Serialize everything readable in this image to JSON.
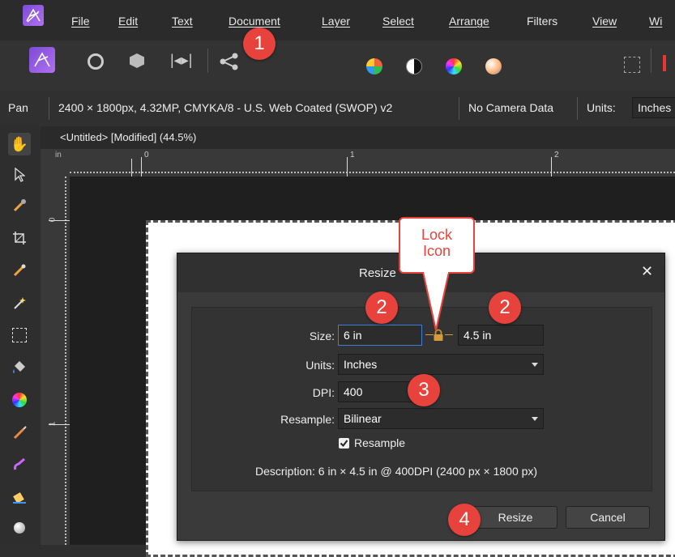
{
  "menubar": {
    "items": [
      "File",
      "Edit",
      "Text",
      "Document",
      "Layer",
      "Select",
      "Arrange",
      "Filters",
      "View",
      "Wi"
    ]
  },
  "contextbar": {
    "tool": "Pan",
    "doc_info": "2400 × 1800px, 4.32MP, CMYKA/8 - U.S. Web Coated (SWOP) v2",
    "camera": "No Camera Data",
    "units_label": "Units:",
    "units_value": "Inches"
  },
  "doc_tab": {
    "title": "<Untitled> [Modified] (44.5%)"
  },
  "ruler": {
    "unit": "in",
    "top_ticks": [
      "0",
      "1",
      "2"
    ],
    "left_ticks": [
      "0",
      "1"
    ]
  },
  "dialog": {
    "title": "Resize",
    "close": "✕",
    "size_label": "Size:",
    "width_value": "6 in",
    "height_value": "4.5 in",
    "units_label": "Units:",
    "units_value": "Inches",
    "dpi_label": "DPI:",
    "dpi_value": "400",
    "resample_label": "Resample:",
    "resample_value": "Bilinear",
    "resample_checkbox_label": "Resample",
    "resample_checked": true,
    "description": "Description: 6 in × 4.5 in @ 400DPI (2400 px × 1800 px)",
    "resize_button": "Resize",
    "cancel_button": "Cancel"
  },
  "annotations": {
    "badge1": "1",
    "badge2a": "2",
    "badge2b": "2",
    "badge3": "3",
    "badge4": "4",
    "callout_line1": "Lock",
    "callout_line2": "Icon",
    "color": "#e8423c"
  }
}
